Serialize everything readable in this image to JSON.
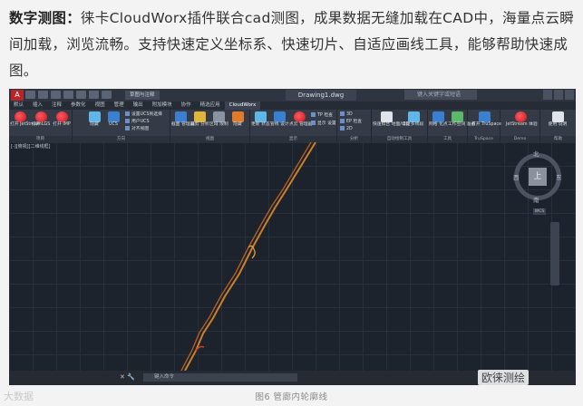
{
  "article": {
    "lead": "数字测图：",
    "text": "徕卡CloudWorx插件联合cad测图，成果数据无缝加载在CAD中，海量点云瞬间加载，浏览流畅。支持快速定义坐标系、快速切片、自适应画线工具，能够帮助快速成图。"
  },
  "app": {
    "doc_title": "Drawing1.dwg",
    "search_placeholder": "键入关键字或短语",
    "workspace": "草图与注释",
    "tabs": [
      "默认",
      "插入",
      "注释",
      "参数化",
      "视图",
      "管理",
      "输出",
      "附加模块",
      "协作",
      "精选应用",
      "CloudWorx"
    ],
    "active_tab": "CloudWorx"
  },
  "ribbon": {
    "groups": [
      {
        "name": "项目",
        "buttons": [
          "打开 JetStream",
          "打开 LGS",
          "打开 IMP"
        ]
      },
      {
        "name": "方向",
        "buttons": [
          "隐藏 ",
          "设置UCS到选择",
          "UCS",
          "用户UCS",
          "对齐视图"
        ]
      },
      {
        "name": "视图",
        "buttons": [
          "截面 管理器",
          "裁剪 分析",
          "区域 限制",
          "隐藏 "
        ]
      },
      {
        "name": "显示",
        "buttons": [
          "管线 设计",
          "TP 检查",
          "显示 设置",
          "更新 状态",
          "点云 管理器"
        ]
      },
      {
        "name": "分析",
        "buttons": [
          "3D",
          "EP 检查",
          "2D",
          "虚拟"
        ]
      },
      {
        "name": "自动绘制工具",
        "buttons": [
          "快速拟合 地面/墙面",
          "2D 多线段"
        ]
      },
      {
        "name": "工具",
        "buttons": [
          "网格 化点",
          "工作空间 准备"
        ]
      },
      {
        "name": "TruSpace",
        "buttons": [
          "打开 TruSpace"
        ]
      },
      {
        "name": "Demo",
        "buttons": [
          "JetStream 体验"
        ]
      },
      {
        "name": "帮助",
        "buttons": [
          "使用 说明"
        ]
      }
    ],
    "toggles": [
      "关闭剪辑",
      "2D 限制",
      "3D限定"
    ]
  },
  "viewport": {
    "label": "[-][俯视][二维线框]",
    "compass": {
      "north": "北",
      "south": "南",
      "west": "西",
      "east": "东",
      "center": "上"
    },
    "wcs": "WCS"
  },
  "command": {
    "placeholder": "键入命令"
  },
  "figure": {
    "caption": "图6   管廊内轮廓线"
  },
  "watermarks": {
    "left": "大数据",
    "right": "欧徕测绘"
  }
}
